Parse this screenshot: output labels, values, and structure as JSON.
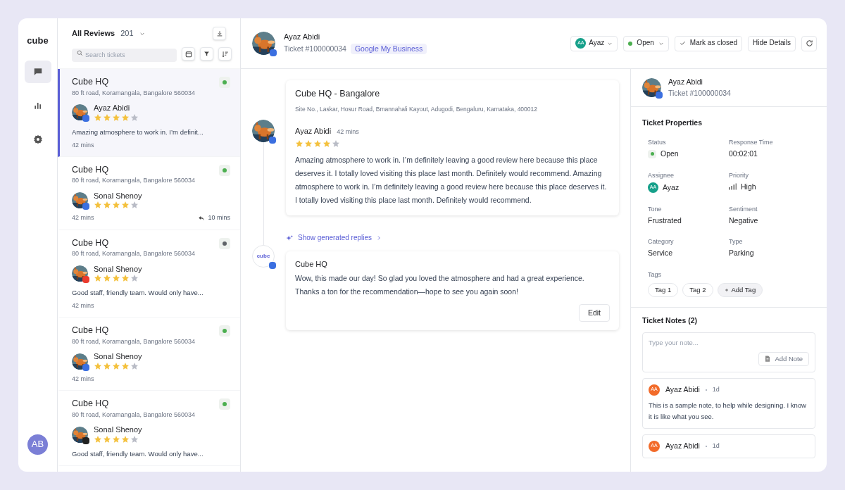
{
  "nav": {
    "logo": "cube",
    "items": [
      {
        "kind": "chat",
        "selected": true
      },
      {
        "kind": "chart",
        "selected": false
      },
      {
        "kind": "settings",
        "selected": false
      }
    ],
    "user_initials": "AB"
  },
  "list": {
    "title": "All Reviews",
    "count": "201",
    "search": {
      "placeholder": "Search tickets"
    },
    "items": [
      {
        "title": "Cube HQ",
        "address": "80 ft road, Koramangala, Bangalore 560034",
        "reviewer": "Ayaz Abidi",
        "stars": 4,
        "source": {
          "color": "#3b6fe0"
        },
        "status": {
          "color": "#4caf50"
        },
        "snippet": "Amazing atmosphere to work in. I’m definit...",
        "time": "42 mins",
        "selected": true
      },
      {
        "title": "Cube HQ",
        "address": "80 ft road, Koramangala, Bangalore 560034",
        "reviewer": "Sonal Shenoy",
        "stars": 4,
        "source": {
          "color": "#3b6fe0"
        },
        "status": {
          "color": "#4caf50"
        },
        "time": "42 mins",
        "reply_time": "10 mins",
        "selected": false
      },
      {
        "title": "Cube HQ",
        "address": "80 ft road, Koramangala, Bangalore 560034",
        "reviewer": "Sonal Shenoy",
        "stars": 4,
        "source": {
          "color": "#ea3b2e"
        },
        "status": {
          "color": "#5f6368"
        },
        "snippet": "Good staff, friendly team. Would only have...",
        "time": "42 mins",
        "selected": false
      },
      {
        "title": "Cube HQ",
        "address": "80 ft road, Koramangala, Bangalore 560034",
        "reviewer": "Sonal Shenoy",
        "stars": 4,
        "source": {
          "color": "#3b6fe0"
        },
        "status": {
          "color": "#4caf50"
        },
        "time": "42 mins",
        "selected": false
      },
      {
        "title": "Cube HQ",
        "address": "80 ft road, Koramangala, Bangalore 560034",
        "reviewer": "Sonal Shenoy",
        "stars": 4,
        "source": {
          "color": "#222222"
        },
        "status": {
          "color": "#4caf50"
        },
        "snippet": "Good staff, friendly team. Would only have...",
        "selected": false
      }
    ]
  },
  "header": {
    "name": "Ayaz Abidi",
    "ticket": "Ticket #100000034",
    "source": "Google My Business",
    "assignee": {
      "initials": "AA",
      "name": "Ayaz"
    },
    "status": "Open",
    "buttons": [
      "Mark as closed",
      "Hide Details"
    ]
  },
  "review": {
    "location": "Cube HQ - Bangalore",
    "address": "Site No., Laskar, Hosur Road, Bmannahali Kayout, Adugodi, Bengaluru, Karnataka, 400012",
    "reviewer": "Ayaz Abidi",
    "time": "42 mins",
    "stars": 4,
    "text": "Amazing atmosphere to work in. I’m definitely leaving a good review here because this place deserves it. I totally loved visiting this place last month. Definitely would recommend. Amazing atmosphere to work in. I’m definitely leaving a good review here because this place deserves it. I totally loved visiting this place last month. Definitely would recommend."
  },
  "generated_replies_link": "Show generated replies",
  "reply": {
    "avatar_text": "cube",
    "author": "Cube HQ",
    "text": "Wow, this made our day! So glad you loved the atmosphere and had a great experience. Thanks a ton for the recommendation—hope to see you again soon!",
    "button": "Edit"
  },
  "details": {
    "name": "Ayaz Abidi",
    "ticket": "Ticket #100000034",
    "properties_title": "Ticket Properties",
    "properties": [
      {
        "label": "Status",
        "value": "Open",
        "kind": "status"
      },
      {
        "label": "Response Time",
        "value": "00:02:01",
        "kind": "plain"
      },
      {
        "label": "Assignee",
        "value": "Ayaz",
        "initials": "AA",
        "kind": "person"
      },
      {
        "label": "Priority",
        "value": "High",
        "kind": "priority"
      },
      {
        "label": "Tone",
        "value": "Frustrated",
        "kind": "plain"
      },
      {
        "label": "Sentiment",
        "value": "Negative",
        "kind": "plain"
      },
      {
        "label": "Category",
        "value": "Service",
        "kind": "plain"
      },
      {
        "label": "Type",
        "value": "Parking",
        "kind": "plain"
      }
    ],
    "tags_label": "Tags",
    "tags": [
      "Tag 1",
      "Tag 2"
    ],
    "add_tag": "Add Tag",
    "notes_title": "Ticket Notes (2)",
    "note_field": {
      "placeholder": "Type your note..."
    },
    "add_note": "Add Note",
    "notes": [
      {
        "initials": "AA",
        "author": "Ayaz Abidi",
        "time": "1d",
        "text": "This is a sample note, to help while designing. I know it is like what you see."
      },
      {
        "initials": "AA",
        "author": "Ayaz Abidi",
        "time": "1d"
      }
    ]
  }
}
